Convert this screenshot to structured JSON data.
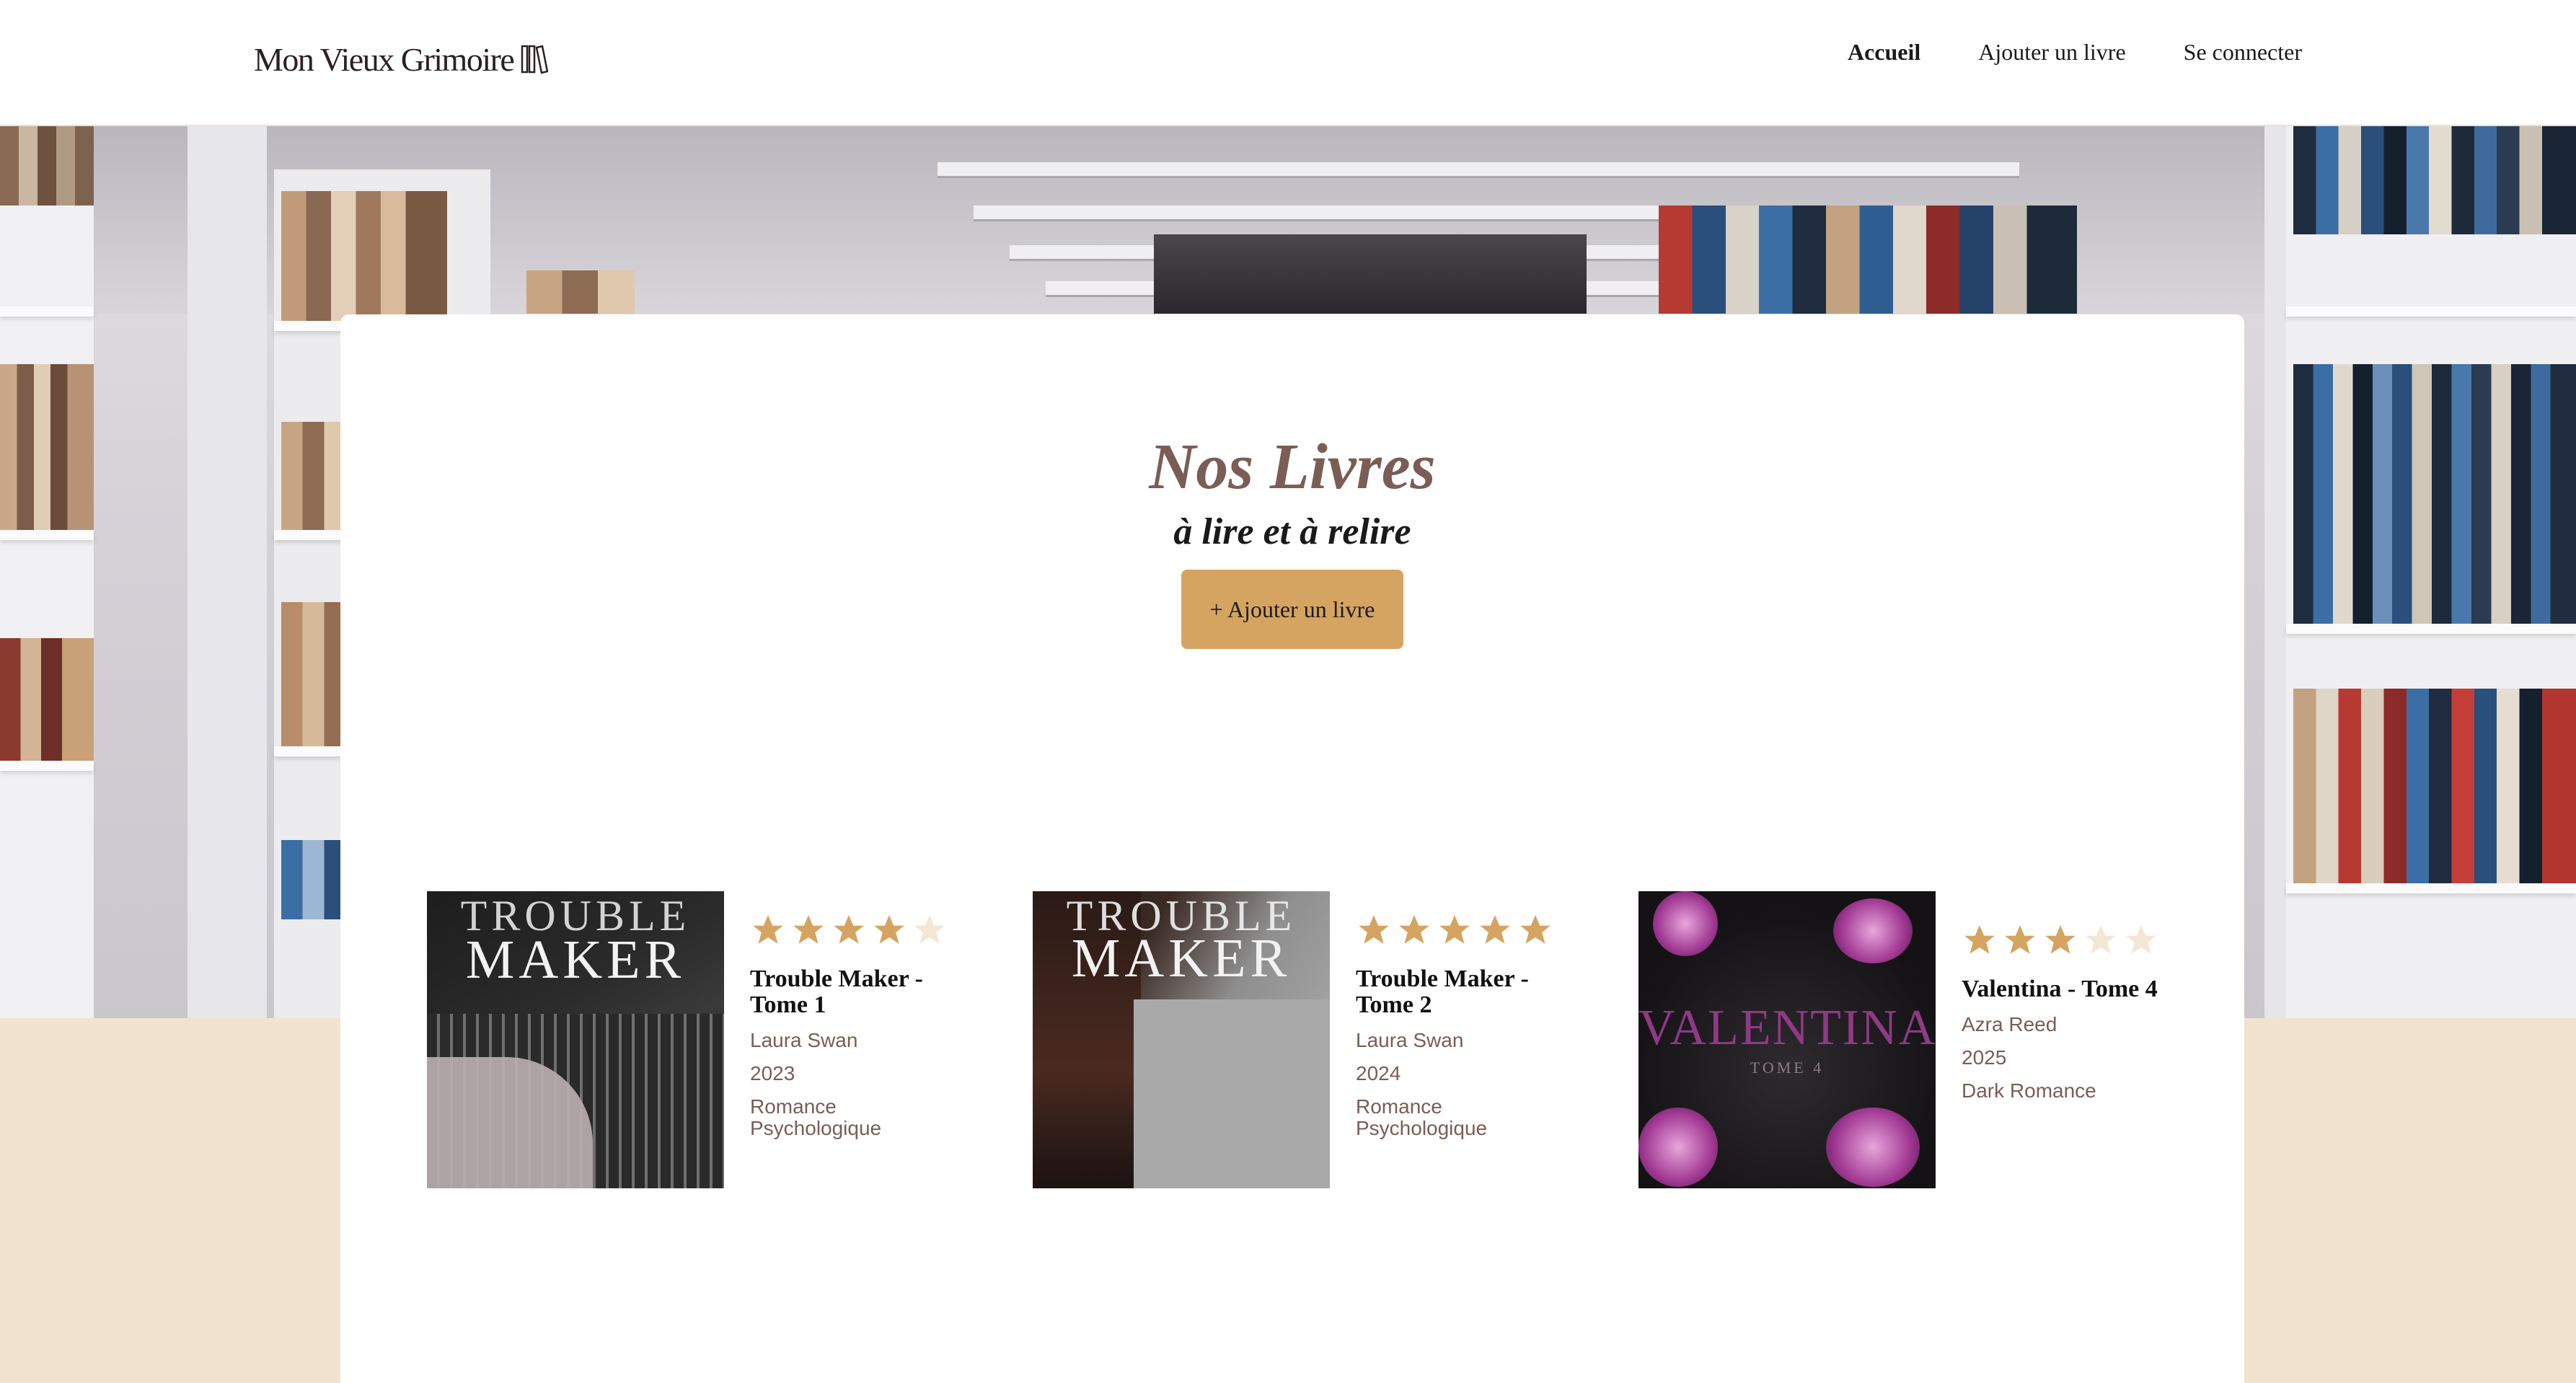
{
  "header": {
    "logo_text": "Mon Vieux Grimoire",
    "nav": [
      {
        "label": "Accueil",
        "active": true
      },
      {
        "label": "Ajouter un livre",
        "active": false
      },
      {
        "label": "Se connecter",
        "active": false
      }
    ]
  },
  "main": {
    "title": "Nos Livres",
    "subtitle": "à lire et à relire",
    "add_button_label": "+ Ajouter un livre"
  },
  "books": [
    {
      "title": "Trouble Maker - Tome 1",
      "author": "Laura Swan",
      "year": "2023",
      "genre": "Romance Psychologique",
      "rating": 4,
      "cover_line1": "TROUBLE",
      "cover_line2": "MAKER"
    },
    {
      "title": "Trouble Maker - Tome 2",
      "author": "Laura Swan",
      "year": "2024",
      "genre": "Romance Psychologique",
      "rating": 5,
      "cover_line1": "TROUBLE",
      "cover_line2": "MAKER"
    },
    {
      "title": "Valentina - Tome 4",
      "author": "Azra Reed",
      "year": "2025",
      "genre": "Dark Romance",
      "rating": 3,
      "cover_line1": "VALENTINA",
      "cover_line2": "TOME 4"
    }
  ],
  "colors": {
    "accent": "#d6a461",
    "star_filled": "#d6a461",
    "star_empty": "#f3e6d3",
    "meta_text": "#7a5d55",
    "beige_background": "#f1e3cf"
  },
  "icons": {
    "logo": "books-icon",
    "rating": "star-icon"
  }
}
